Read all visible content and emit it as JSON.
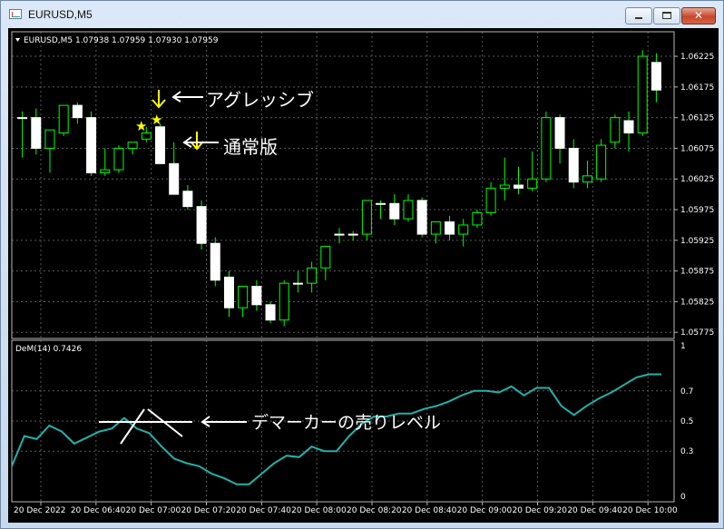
{
  "window": {
    "title": "EURUSD,M5",
    "buttons": {
      "minimize_icon": "minimize-icon",
      "maximize_icon": "maximize-icon",
      "close_icon": "close-icon"
    }
  },
  "chart": {
    "header": "EURUSD,M5  1.07938 1.07959 1.07930 1.07959",
    "price_ticks": [
      "1.06225",
      "1.06175",
      "1.06125",
      "1.06075",
      "1.06025",
      "1.05975",
      "1.05925",
      "1.05875",
      "1.05825",
      "1.05775"
    ],
    "time_ticks": [
      "20 Dec 2022",
      "20 Dec 06:40",
      "20 Dec 07:00",
      "20 Dec 07:20",
      "20 Dec 07:40",
      "20 Dec 08:00",
      "20 Dec 08:20",
      "20 Dec 08:40",
      "20 Dec 09:00",
      "20 Dec 09:20",
      "20 Dec 09:40",
      "20 Dec 10:00"
    ],
    "colors": {
      "background": "#000000",
      "grid": "#5a5a5a",
      "bull_body": "#000000",
      "bear_body": "#ffffff",
      "wick": "#00ff00",
      "indicator": "#20b2aa",
      "annotation": "#ffff00"
    },
    "annotations": {
      "aggressive": "アグレッシブ",
      "normal": "通常版",
      "dem_sell_level": "デマーカーの売りレベル"
    }
  },
  "indicator": {
    "label": "DeM(14) 0.7426",
    "ticks": [
      "1",
      "0.7",
      "0.5",
      "0.3",
      "0"
    ]
  },
  "chart_data": [
    {
      "type": "candlestick",
      "title": "EURUSD,M5",
      "ylim": [
        1.05765,
        1.06265
      ],
      "candles": [
        {
          "o": 1.06125,
          "h": 1.06135,
          "l": 1.0606,
          "c": 1.06125
        },
        {
          "o": 1.06125,
          "h": 1.0614,
          "l": 1.06065,
          "c": 1.06075
        },
        {
          "o": 1.06075,
          "h": 1.06105,
          "l": 1.06035,
          "c": 1.06105
        },
        {
          "o": 1.061,
          "h": 1.06145,
          "l": 1.06095,
          "c": 1.06145
        },
        {
          "o": 1.06145,
          "h": 1.0615,
          "l": 1.06115,
          "c": 1.06125
        },
        {
          "o": 1.06125,
          "h": 1.06135,
          "l": 1.0603,
          "c": 1.06035
        },
        {
          "o": 1.06035,
          "h": 1.06075,
          "l": 1.0603,
          "c": 1.0604
        },
        {
          "o": 1.0604,
          "h": 1.0608,
          "l": 1.06035,
          "c": 1.06075
        },
        {
          "o": 1.06075,
          "h": 1.06085,
          "l": 1.06065,
          "c": 1.06085
        },
        {
          "o": 1.0609,
          "h": 1.0611,
          "l": 1.06085,
          "c": 1.061
        },
        {
          "o": 1.0611,
          "h": 1.06115,
          "l": 1.0609,
          "c": 1.0605
        },
        {
          "o": 1.0605,
          "h": 1.06085,
          "l": 1.0604,
          "c": 1.06
        },
        {
          "o": 1.06005,
          "h": 1.06015,
          "l": 1.05975,
          "c": 1.0598
        },
        {
          "o": 1.0598,
          "h": 1.0599,
          "l": 1.0591,
          "c": 1.0592
        },
        {
          "o": 1.0592,
          "h": 1.0593,
          "l": 1.0585,
          "c": 1.0586
        },
        {
          "o": 1.05865,
          "h": 1.05875,
          "l": 1.058,
          "c": 1.05815
        },
        {
          "o": 1.05815,
          "h": 1.0585,
          "l": 1.058,
          "c": 1.0585
        },
        {
          "o": 1.0585,
          "h": 1.0586,
          "l": 1.0581,
          "c": 1.0582
        },
        {
          "o": 1.0582,
          "h": 1.05825,
          "l": 1.0579,
          "c": 1.05795
        },
        {
          "o": 1.05795,
          "h": 1.0586,
          "l": 1.05785,
          "c": 1.05855
        },
        {
          "o": 1.05855,
          "h": 1.05875,
          "l": 1.0584,
          "c": 1.05855
        },
        {
          "o": 1.05855,
          "h": 1.0589,
          "l": 1.0584,
          "c": 1.0588
        },
        {
          "o": 1.0588,
          "h": 1.05915,
          "l": 1.0586,
          "c": 1.05915
        },
        {
          "o": 1.05935,
          "h": 1.05945,
          "l": 1.0592,
          "c": 1.05935
        },
        {
          "o": 1.05935,
          "h": 1.0594,
          "l": 1.05925,
          "c": 1.05935
        },
        {
          "o": 1.05935,
          "h": 1.0599,
          "l": 1.05925,
          "c": 1.0599
        },
        {
          "o": 1.05985,
          "h": 1.0599,
          "l": 1.0596,
          "c": 1.05985
        },
        {
          "o": 1.05985,
          "h": 1.06,
          "l": 1.0595,
          "c": 1.0596
        },
        {
          "o": 1.0596,
          "h": 1.06,
          "l": 1.05955,
          "c": 1.0599
        },
        {
          "o": 1.0599,
          "h": 1.05995,
          "l": 1.0593,
          "c": 1.05935
        },
        {
          "o": 1.05935,
          "h": 1.05955,
          "l": 1.0592,
          "c": 1.05955
        },
        {
          "o": 1.05955,
          "h": 1.05965,
          "l": 1.05925,
          "c": 1.05935
        },
        {
          "o": 1.05935,
          "h": 1.0596,
          "l": 1.05915,
          "c": 1.0595
        },
        {
          "o": 1.0595,
          "h": 1.05975,
          "l": 1.05945,
          "c": 1.0597
        },
        {
          "o": 1.0597,
          "h": 1.0602,
          "l": 1.05965,
          "c": 1.0601
        },
        {
          "o": 1.0601,
          "h": 1.0606,
          "l": 1.0599,
          "c": 1.06015
        },
        {
          "o": 1.06015,
          "h": 1.06045,
          "l": 1.06,
          "c": 1.0601
        },
        {
          "o": 1.0601,
          "h": 1.0607,
          "l": 1.06005,
          "c": 1.06025
        },
        {
          "o": 1.06025,
          "h": 1.06135,
          "l": 1.0602,
          "c": 1.06125
        },
        {
          "o": 1.06125,
          "h": 1.0613,
          "l": 1.0605,
          "c": 1.06075
        },
        {
          "o": 1.06075,
          "h": 1.0609,
          "l": 1.0601,
          "c": 1.0602
        },
        {
          "o": 1.0602,
          "h": 1.06055,
          "l": 1.0601,
          "c": 1.0603
        },
        {
          "o": 1.06025,
          "h": 1.0609,
          "l": 1.0602,
          "c": 1.0608
        },
        {
          "o": 1.06085,
          "h": 1.0613,
          "l": 1.06075,
          "c": 1.06125
        },
        {
          "o": 1.0612,
          "h": 1.06135,
          "l": 1.0607,
          "c": 1.061
        },
        {
          "o": 1.061,
          "h": 1.06235,
          "l": 1.06095,
          "c": 1.06225
        },
        {
          "o": 1.06215,
          "h": 1.0623,
          "l": 1.0615,
          "c": 1.0617
        }
      ]
    },
    {
      "type": "line",
      "title": "DeM(14) 0.7426",
      "ylim": [
        0,
        1
      ],
      "series": [
        {
          "name": "DeM(14)",
          "values": [
            0.2,
            0.4,
            0.38,
            0.47,
            0.43,
            0.35,
            0.39,
            0.43,
            0.45,
            0.52,
            0.45,
            0.42,
            0.33,
            0.25,
            0.22,
            0.2,
            0.15,
            0.12,
            0.08,
            0.08,
            0.15,
            0.22,
            0.27,
            0.26,
            0.33,
            0.3,
            0.3,
            0.4,
            0.48,
            0.53,
            0.53,
            0.55,
            0.55,
            0.58,
            0.6,
            0.63,
            0.67,
            0.7,
            0.7,
            0.69,
            0.73,
            0.67,
            0.72,
            0.72,
            0.6,
            0.54,
            0.6,
            0.65,
            0.69,
            0.74,
            0.79,
            0.81,
            0.81
          ]
        }
      ]
    }
  ]
}
